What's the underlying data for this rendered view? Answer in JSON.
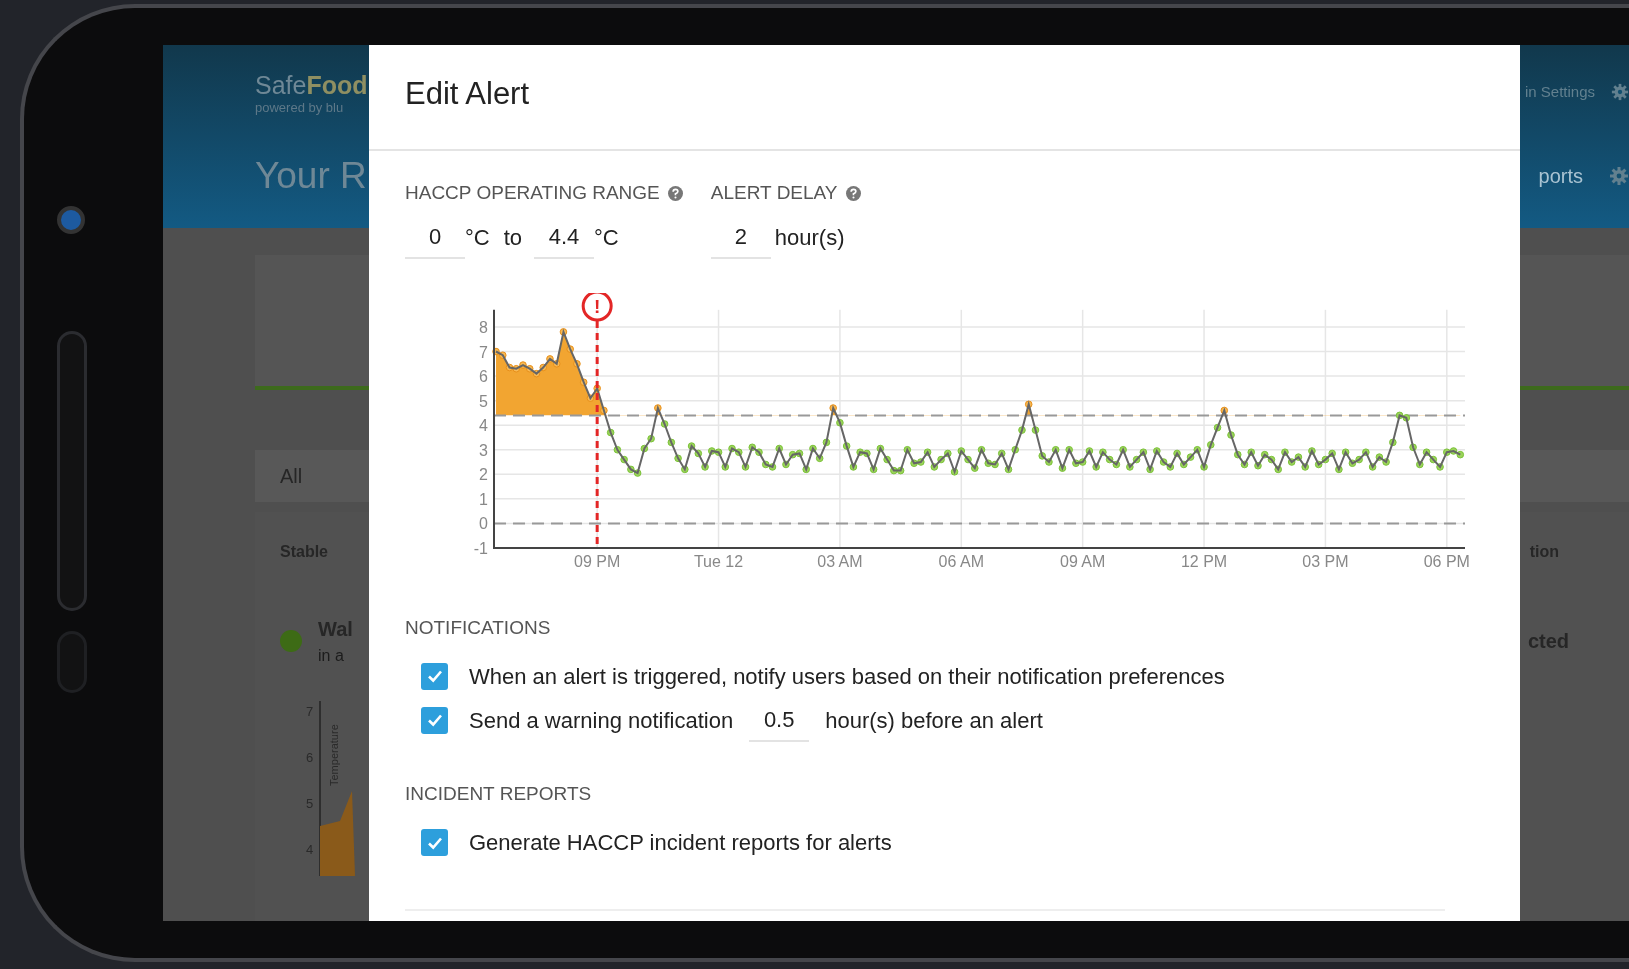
{
  "background_app": {
    "logo": "Safe**Food**",
    "logo_tagline": "powered by blu",
    "page_title": "Your R",
    "header_link": "in Settings",
    "nav_link": "ports",
    "filter": "All",
    "list_header_left": "Stable",
    "list_header_right": "tion",
    "item_name": "Wal",
    "item_subtitle": "in a",
    "item_status": "cted",
    "mini_chart_axis_label": "Temperature",
    "mini_chart_ticks": [
      "7",
      "6",
      "5",
      "4"
    ]
  },
  "modal": {
    "title": "Edit Alert",
    "operating_range": {
      "label": "HACCP OPERATING RANGE",
      "min": "0",
      "min_unit": "°C",
      "separator": "to",
      "max": "4.4",
      "max_unit": "°C"
    },
    "alert_delay": {
      "label": "ALERT DELAY",
      "value": "2",
      "unit": "hour(s)"
    },
    "chart_data": {
      "type": "line",
      "grid": true,
      "ylim": [
        -1,
        8.7
      ],
      "yticks": [
        -1,
        0,
        1,
        2,
        3,
        4,
        5,
        6,
        7,
        8
      ],
      "categories": [
        null,
        null,
        null,
        null,
        null,
        null,
        null,
        null,
        null,
        null,
        null,
        null,
        null,
        null,
        null,
        "09 PM",
        null,
        null,
        null,
        null,
        null,
        null,
        null,
        null,
        null,
        null,
        null,
        null,
        null,
        null,
        null,
        null,
        null,
        "Tue 12",
        null,
        null,
        null,
        null,
        null,
        null,
        null,
        null,
        null,
        null,
        null,
        null,
        null,
        null,
        null,
        null,
        null,
        "03 AM",
        null,
        null,
        null,
        null,
        null,
        null,
        null,
        null,
        null,
        null,
        null,
        null,
        null,
        null,
        null,
        null,
        null,
        "06 AM",
        null,
        null,
        null,
        null,
        null,
        null,
        null,
        null,
        null,
        null,
        null,
        null,
        null,
        null,
        null,
        null,
        null,
        "09 AM",
        null,
        null,
        null,
        null,
        null,
        null,
        null,
        null,
        null,
        null,
        null,
        null,
        null,
        null,
        null,
        null,
        null,
        "12 PM",
        null,
        null,
        null,
        null,
        null,
        null,
        null,
        null,
        null,
        null,
        null,
        null,
        null,
        null,
        null,
        null,
        null,
        "03 PM",
        null,
        null,
        null,
        null,
        null,
        null,
        null,
        null,
        null,
        null,
        null,
        null,
        null,
        null,
        null,
        null,
        null,
        "06 PM",
        null,
        null
      ],
      "series": [
        {
          "color": "#666666",
          "marker": "circle",
          "values": [
            7.0,
            6.85,
            6.35,
            6.3,
            6.45,
            6.3,
            6.1,
            6.35,
            6.7,
            6.5,
            7.8,
            7.1,
            6.5,
            5.75,
            5.1,
            5.5,
            4.6,
            3.7,
            3.0,
            2.6,
            2.2,
            2.05,
            3.05,
            3.45,
            4.7,
            4.05,
            3.3,
            2.65,
            2.2,
            3.15,
            2.85,
            2.3,
            2.95,
            2.9,
            2.3,
            3.05,
            2.9,
            2.3,
            3.1,
            2.9,
            2.4,
            2.3,
            3.05,
            2.4,
            2.8,
            2.85,
            2.2,
            3.05,
            2.65,
            3.3,
            4.7,
            4.1,
            3.15,
            2.3,
            2.9,
            2.85,
            2.2,
            3.05,
            2.6,
            2.15,
            2.15,
            3.0,
            2.45,
            2.5,
            2.9,
            2.3,
            2.6,
            2.85,
            2.1,
            2.95,
            2.6,
            2.25,
            3.0,
            2.45,
            2.4,
            2.85,
            2.2,
            3.0,
            3.8,
            4.85,
            3.8,
            2.75,
            2.5,
            3.0,
            2.25,
            3.0,
            2.45,
            2.5,
            2.95,
            2.3,
            2.9,
            2.6,
            2.4,
            3.0,
            2.3,
            2.6,
            2.9,
            2.2,
            2.95,
            2.5,
            2.3,
            2.85,
            2.4,
            2.7,
            3.0,
            2.3,
            3.2,
            3.9,
            4.6,
            3.6,
            2.8,
            2.4,
            2.9,
            2.35,
            2.8,
            2.6,
            2.2,
            2.9,
            2.5,
            2.7,
            2.3,
            2.95,
            2.4,
            2.6,
            2.85,
            2.2,
            2.9,
            2.45,
            2.6,
            2.9,
            2.3,
            2.7,
            2.5,
            3.3,
            4.4,
            4.3,
            3.1,
            2.4,
            2.9,
            2.6,
            2.3,
            2.9,
            2.95,
            2.8
          ]
        }
      ],
      "ref_lines": [
        {
          "axis": "y",
          "value": 4.4
        },
        {
          "axis": "y",
          "value": 0
        }
      ],
      "annotations": [
        {
          "x": "09 PM",
          "text": "!"
        }
      ]
    },
    "notifications": {
      "heading": "NOTIFICATIONS",
      "options": [
        {
          "kind": "plain",
          "checked": true,
          "label": "When an alert is triggered, notify users based on their notification preferences"
        },
        {
          "kind": "warning",
          "checked": true,
          "label_before": "Send a warning notification",
          "value": "0.5",
          "label_after": "hour(s) before an alert"
        }
      ]
    },
    "incident_reports": {
      "heading": "INCIDENT REPORTS",
      "options": [
        {
          "kind": "plain",
          "checked": true,
          "label": "Generate HACCP incident reports for alerts"
        }
      ]
    }
  }
}
